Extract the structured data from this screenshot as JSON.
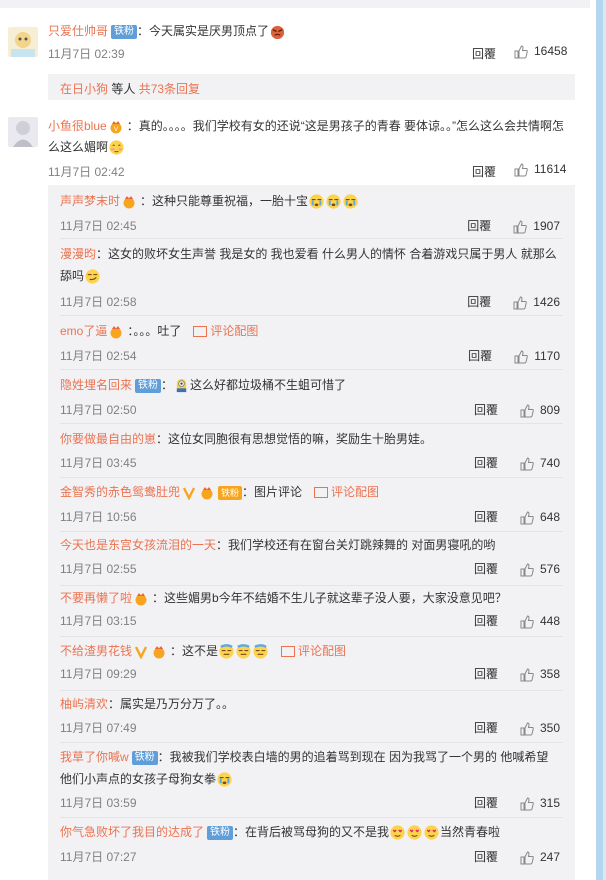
{
  "comments": [
    {
      "user": "只爱仕帅哥",
      "badge": "铁粉",
      "text": "：今天属实是厌男顶点了",
      "time": "11月7日 02:39",
      "reply": "回覆",
      "likes": "16458"
    },
    {
      "user": "小鱼很blue",
      "text": "：真的。。。。我们学校有女的还说“这是男孩子的青春 要体谅。。”怎么这么会共情啊怎么这么媚啊",
      "time": "11月7日 02:42",
      "reply": "回覆",
      "likes": "11614"
    }
  ],
  "more_replies": {
    "user": "在日小狗",
    "middle": " 等人 ",
    "count_text": "共73条回复"
  },
  "replies": [
    {
      "user": "声声梦末时",
      "text": "：这种只能尊重祝福，一胎十宝",
      "time": "11月7日 02:45",
      "reply": "回覆",
      "likes": "1907"
    },
    {
      "user": "漫漫昀",
      "text": "：这女的败坏女生声誉 我是女的 我也爱看 什么男人的情怀 合着游戏只属于男人 就那么舔吗",
      "time": "11月7日 02:58",
      "reply": "回覆",
      "likes": "1426"
    },
    {
      "user": "emo了逼",
      "text": "：。。。吐了",
      "pic": "评论配图",
      "time": "11月7日 02:54",
      "reply": "回覆",
      "likes": "1170"
    },
    {
      "user": "隐姓埋名回来",
      "badge": "铁粉",
      "text": "：这么好都垃圾桶不生蛆可惜了",
      "time": "11月7日 02:50",
      "reply": "回覆",
      "likes": "809"
    },
    {
      "user": "你要做最自由的崽",
      "text": "：这位女同胞很有思想觉悟的嘛，奖励生十胎男娃。",
      "time": "11月7日 03:45",
      "reply": "回覆",
      "likes": "740"
    },
    {
      "user": "金智秀的赤色鸳鸯肚兜",
      "badge": "铁粉",
      "text": "：图片评论",
      "pic": "评论配图",
      "time": "11月7日 10:56",
      "reply": "回覆",
      "likes": "648"
    },
    {
      "user": "今天也是东宫女孩流泪的一天",
      "text": "：我们学校还有在窗台关灯跳辣舞的 对面男寝吼的哟",
      "time": "11月7日 02:55",
      "reply": "回覆",
      "likes": "576"
    },
    {
      "user": "不要再懒了啦",
      "text": "：这些媚男b今年不结婚不生儿子就这辈子没人要，大家没意见吧？",
      "time": "11月7日 03:15",
      "reply": "回覆",
      "likes": "448"
    },
    {
      "user": "不给渣男花钱",
      "text": "：这不是",
      "pic": "评论配图",
      "time": "11月7日 09:29",
      "reply": "回覆",
      "likes": "358"
    },
    {
      "user": "柚屿清欢",
      "text": "：属实是乃万分万了。。",
      "time": "11月7日 07:49",
      "reply": "回覆",
      "likes": "350"
    },
    {
      "user": "我草了你喊w",
      "badge": "铁粉",
      "text": "：我被我们学校表白墙的男的追着骂到现在 因为我骂了一个男的 他喊希望他们小声点的女孩子母狗女拳",
      "time": "11月7日 03:59",
      "reply": "回覆",
      "likes": "315"
    },
    {
      "user": "你气急败坏了我目的达成了",
      "badge": "铁粉",
      "text": "：在背后被骂母狗的又不是我",
      "text_after": "当然青春啦",
      "time": "11月7日 07:27",
      "reply": "回覆",
      "likes": "247"
    }
  ],
  "colors": {
    "username": "#eb7350",
    "badge": "#5f9ed8",
    "panel": "#f2f2f5",
    "time": "#808080",
    "scrollbar": "#b5d6ef"
  }
}
